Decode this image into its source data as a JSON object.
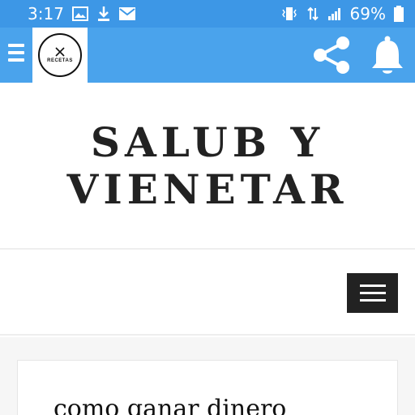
{
  "status_bar": {
    "time": "3:17",
    "battery": "69%",
    "icons": [
      "image-icon",
      "download-icon",
      "mail-icon",
      "vibrate-icon",
      "data-icon",
      "signal-icon",
      "battery-icon"
    ]
  },
  "app_bar": {
    "logo_text": "RECETAS",
    "icons": [
      "menu-icon",
      "share-icon",
      "bell-icon"
    ]
  },
  "site": {
    "title": "SALUB Y VIENETAR"
  },
  "nav": {
    "toggle_icon": "hamburger-icon"
  },
  "post": {
    "title": "como ganar dinero"
  },
  "colors": {
    "status_bar": "#3d97e6",
    "app_bar": "#4aa3ec",
    "nav_toggle": "#222222",
    "title_text": "#222222"
  }
}
